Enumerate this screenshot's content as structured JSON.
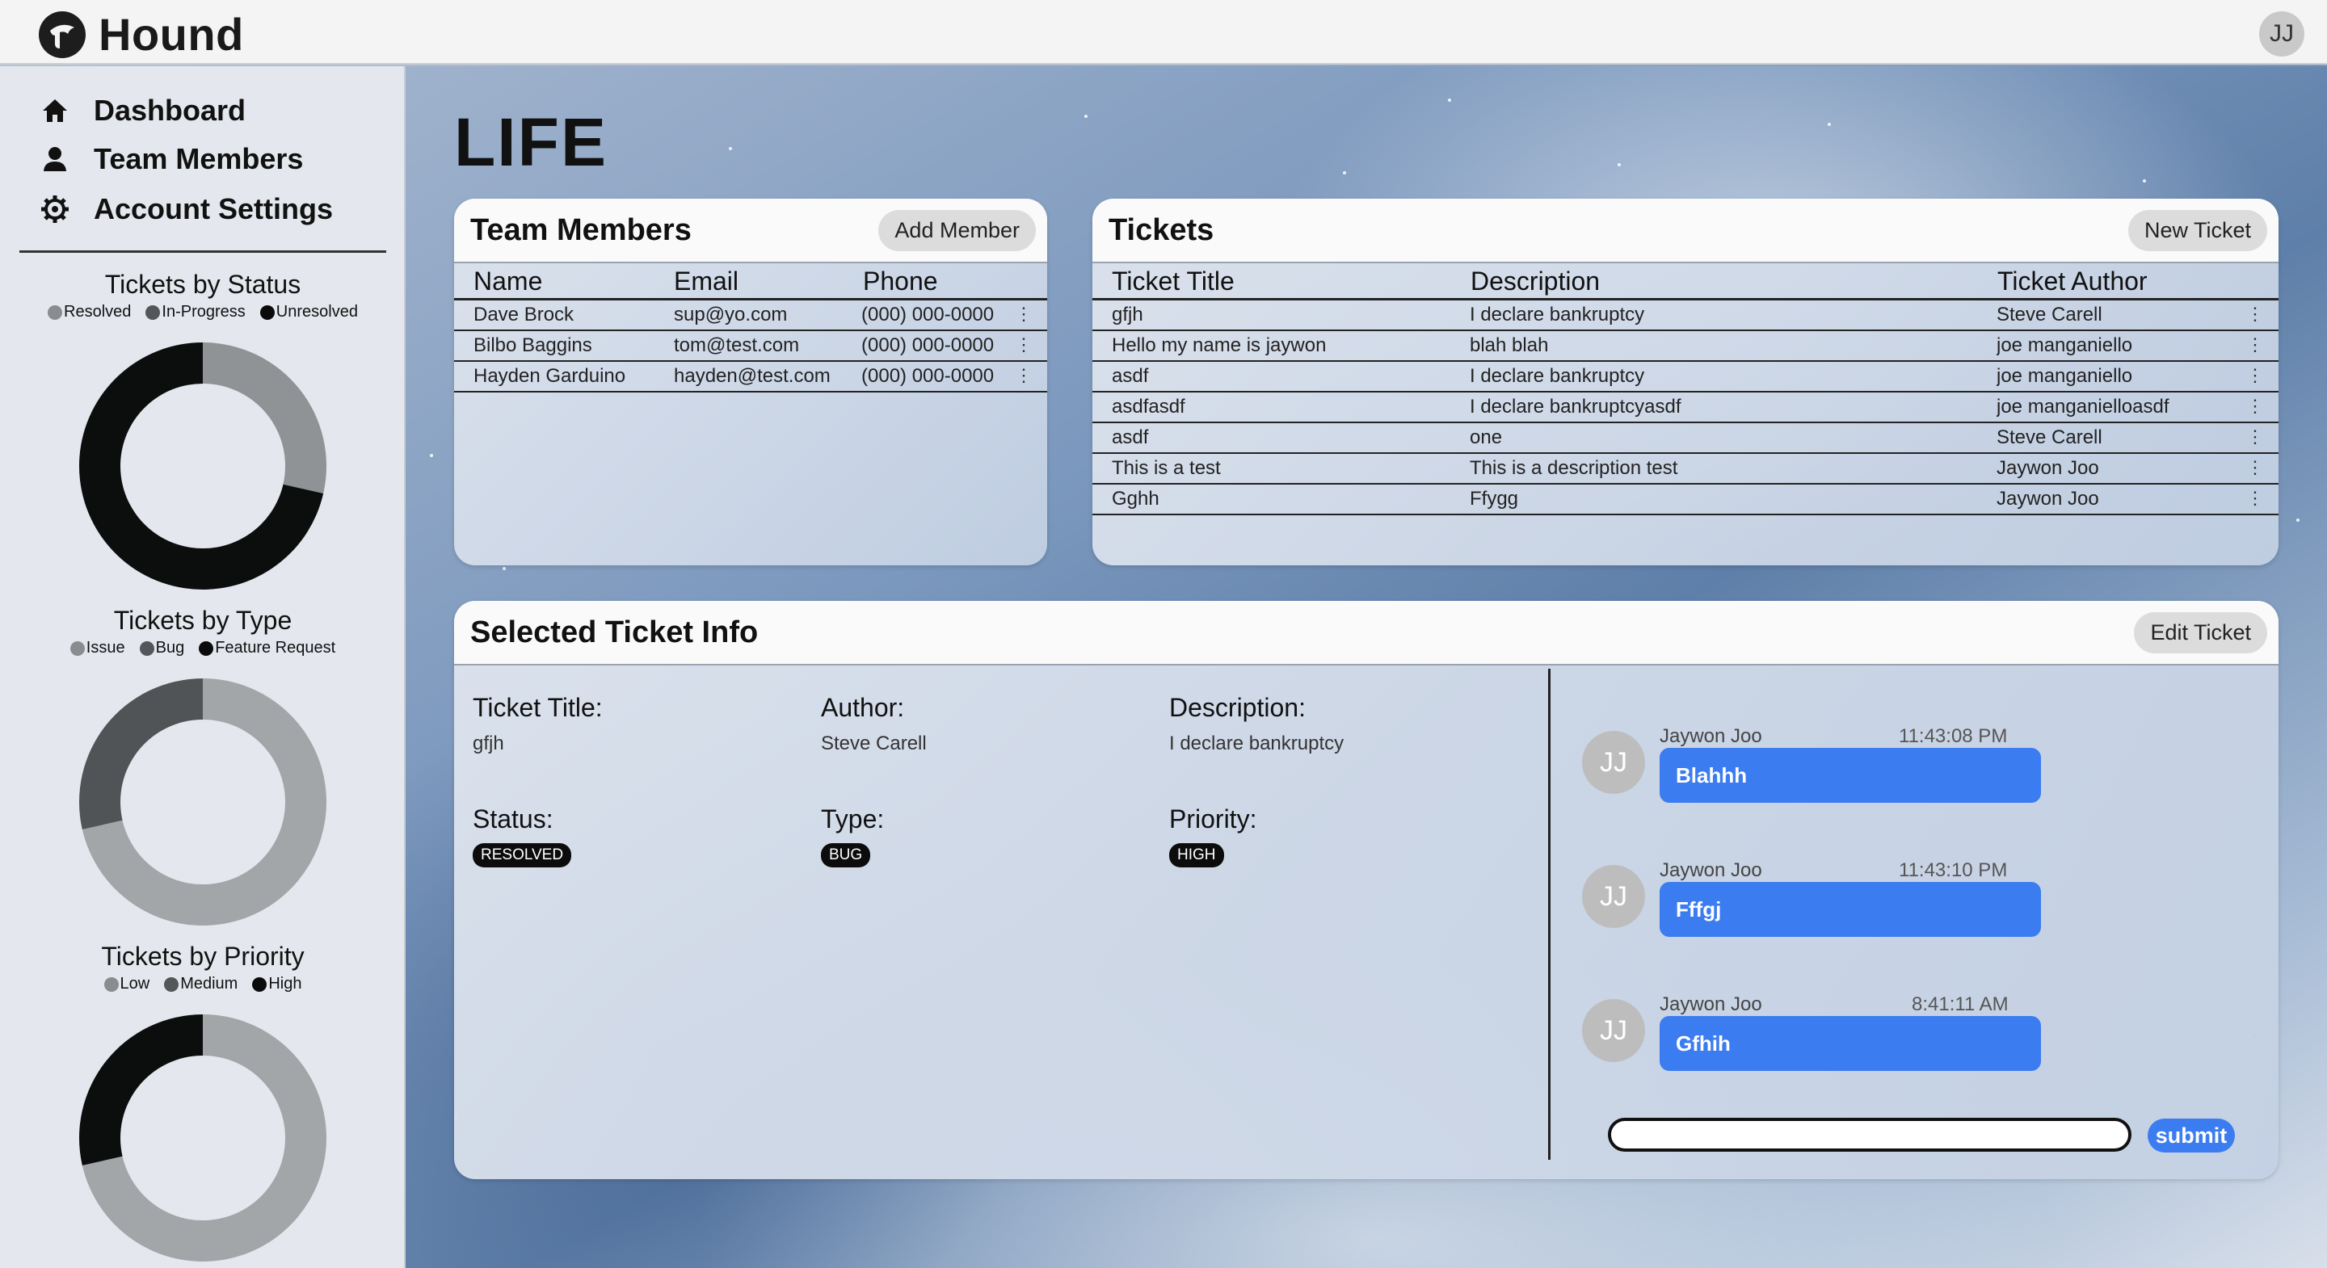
{
  "app": {
    "name": "Hound",
    "user_initials": "JJ"
  },
  "sidebar": {
    "nav": [
      {
        "label": "Dashboard",
        "icon": "home-icon"
      },
      {
        "label": "Team Members",
        "icon": "person-icon"
      },
      {
        "label": "Account Settings",
        "icon": "gear-icon"
      }
    ],
    "charts": [
      {
        "title": "Tickets by Status",
        "legend": [
          {
            "label": "Resolved",
            "color": "#8a8d90"
          },
          {
            "label": "In-Progress",
            "color": "#53575a"
          },
          {
            "label": "Unresolved",
            "color": "#0b0b0b"
          }
        ]
      },
      {
        "title": "Tickets by Type",
        "legend": [
          {
            "label": "Issue",
            "color": "#8a8d90"
          },
          {
            "label": "Bug",
            "color": "#53575a"
          },
          {
            "label": "Feature Request",
            "color": "#0b0b0b"
          }
        ]
      },
      {
        "title": "Tickets by Priority",
        "legend": [
          {
            "label": "Low",
            "color": "#8a8d90"
          },
          {
            "label": "Medium",
            "color": "#53575a"
          },
          {
            "label": "High",
            "color": "#0b0b0b"
          }
        ]
      }
    ]
  },
  "chart_data": [
    {
      "type": "pie",
      "title": "Tickets by Status",
      "categories": [
        "Resolved",
        "In-Progress",
        "Unresolved"
      ],
      "values": [
        2,
        0,
        5
      ],
      "colors": [
        "#8f9396",
        "#55595c",
        "#0c0d0d"
      ]
    },
    {
      "type": "pie",
      "title": "Tickets by Type",
      "categories": [
        "Issue",
        "Bug",
        "Feature Request"
      ],
      "values": [
        5,
        2,
        0
      ],
      "colors": [
        "#a3a6a8",
        "#505456",
        "#0c0d0d"
      ]
    },
    {
      "type": "pie",
      "title": "Tickets by Priority",
      "categories": [
        "Low",
        "Medium",
        "High"
      ],
      "values": [
        5,
        0,
        2
      ],
      "colors": [
        "#a3a6a8",
        "#505456",
        "#0c0d0d"
      ]
    }
  ],
  "project": {
    "title": "LIFE"
  },
  "team": {
    "title": "Team Members",
    "add_button": "Add Member",
    "columns": [
      "Name",
      "Email",
      "Phone"
    ],
    "rows": [
      [
        "Dave Brock",
        "sup@yo.com",
        "(000) 000-0000"
      ],
      [
        "Bilbo Baggins",
        "tom@test.com",
        "(000) 000-0000"
      ],
      [
        "Hayden Garduino",
        "hayden@test.com",
        "(000) 000-0000"
      ]
    ]
  },
  "tickets": {
    "title": "Tickets",
    "new_button": "New Ticket",
    "columns": [
      "Ticket Title",
      "Description",
      "Ticket Author"
    ],
    "rows": [
      [
        "gfjh",
        "I declare bankruptcy",
        "Steve Carell"
      ],
      [
        "Hello my name is jaywon",
        "blah blah",
        "joe manganiello"
      ],
      [
        "asdf",
        "I declare bankruptcy",
        "joe manganiello"
      ],
      [
        "asdfasdf",
        "I declare bankruptcyasdf",
        "joe manganielloasdf"
      ],
      [
        "asdf",
        "one",
        "Steve Carell"
      ],
      [
        "This is a test",
        "This is a description test",
        "Jaywon Joo"
      ],
      [
        "Gghh",
        "Ffygg",
        "Jaywon Joo"
      ]
    ]
  },
  "selected": {
    "title": "Selected Ticket Info",
    "edit_button": "Edit Ticket",
    "labels": {
      "title": "Ticket Title:",
      "author": "Author:",
      "description": "Description:",
      "status": "Status:",
      "type": "Type:",
      "priority": "Priority:"
    },
    "values": {
      "title": "gfjh",
      "author": "Steve Carell",
      "description": "I declare bankruptcy",
      "status": "RESOLVED",
      "type": "BUG",
      "priority": "HIGH"
    }
  },
  "comments": [
    {
      "avatar": "JJ",
      "author": "Jaywon Joo",
      "time": "11:43:08 PM",
      "text": "Blahhh"
    },
    {
      "avatar": "JJ",
      "author": "Jaywon Joo",
      "time": "11:43:10 PM",
      "text": "Fffgj"
    },
    {
      "avatar": "JJ",
      "author": "Jaywon Joo",
      "time": "8:41:11 AM",
      "text": "Gfhih"
    }
  ],
  "chat": {
    "input_value": "",
    "submit_label": "submit"
  }
}
